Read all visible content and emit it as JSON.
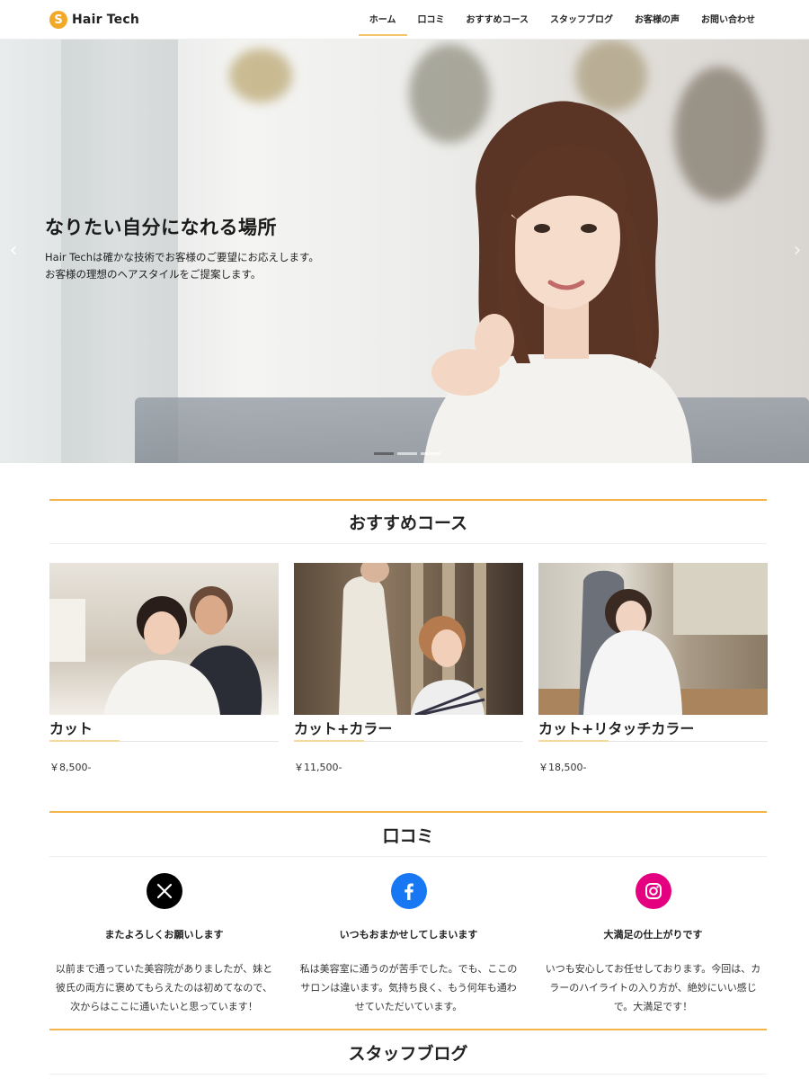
{
  "header": {
    "logo_mark": "S",
    "logo_text": "Hair Tech",
    "nav": [
      "ホーム",
      "口コミ",
      "おすすめコース",
      "スタッフブログ",
      "お客様の声",
      "お問い合わせ"
    ]
  },
  "hero": {
    "title": "なりたい自分になれる場所",
    "line1": "Hair Techは確かな技術でお客様のご要望にお応えします。",
    "line2": "お客様の理想のヘアスタイルをご提案します。",
    "prev": "‹",
    "next": "›"
  },
  "courses": {
    "title": "おすすめコース",
    "items": [
      {
        "name": "カット",
        "price": "￥8,500-"
      },
      {
        "name": "カット+カラー",
        "price": "￥11,500-"
      },
      {
        "name": "カット+リタッチカラー",
        "price": "￥18,500-"
      }
    ]
  },
  "reviews": {
    "title": "口コミ",
    "items": [
      {
        "icon": "x-icon",
        "title": "またよろしくお願いします",
        "line1": "以前まで通っていた美容院がありましたが、妹と",
        "line2": "彼氏の両方に褒めてもらえたのは初めてなので、",
        "line3": "次からはここに通いたいと思っています！"
      },
      {
        "icon": "facebook-icon",
        "title": "いつもおまかせしてしまいます",
        "line1": "私は美容室に通うのが苦手でした。でも、ここの",
        "line2": "サロンは違います。気持ち良く、もう何年も通わ",
        "line3": "せていただいています。"
      },
      {
        "icon": "instagram-icon",
        "title": "大満足の仕上がりです",
        "line1": "いつも安心してお任せしております。今回は、カ",
        "line2": "ラーのハイライトの入り方が、絶妙にいい感じ",
        "line3": "で。大満足です！"
      }
    ]
  },
  "blog": {
    "title": "スタッフブログ"
  },
  "colors": {
    "accent": "#f3a928",
    "x": "#000000",
    "facebook": "#1877f2",
    "instagram": "#e4007f"
  }
}
